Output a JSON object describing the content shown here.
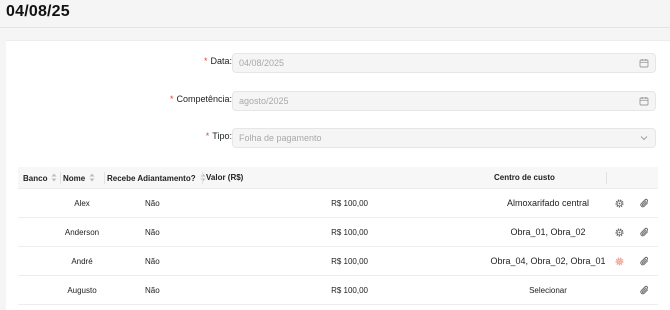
{
  "page": {
    "title": "04/08/25"
  },
  "form": {
    "fields": [
      {
        "label": "Data",
        "value": "04/08/2025",
        "icon": "calendar-icon"
      },
      {
        "label": "Competência",
        "value": "agosto/2025",
        "icon": "calendar-icon"
      },
      {
        "label": "Tipo",
        "value": "Folha de pagamento",
        "icon": "chevron-down-icon"
      }
    ]
  },
  "table": {
    "headers": {
      "banco": "Banco",
      "nome": "Nome",
      "adiantamento": "Recebe Adiantamento?",
      "valor": "Valor (R$)",
      "centro": "Centro de custo"
    },
    "rows": [
      {
        "nome": "Alex",
        "adiantamento": "Não",
        "valor": "R$ 100,00",
        "centro": "Almoxarifado central"
      },
      {
        "nome": "Anderson",
        "adiantamento": "Não",
        "valor": "R$ 100,00",
        "centro": "Obra_01, Obra_02"
      },
      {
        "nome": "André",
        "adiantamento": "Não",
        "valor": "R$ 100,00",
        "centro": "Obra_04, Obra_02, Obra_01"
      },
      {
        "nome": "Augusto",
        "adiantamento": "Não",
        "valor": "R$ 100,00",
        "centro": "Selecionar"
      }
    ]
  },
  "colors": {
    "required": "#e0453a",
    "gear_active": "#f0a595",
    "icon": "#555555"
  }
}
